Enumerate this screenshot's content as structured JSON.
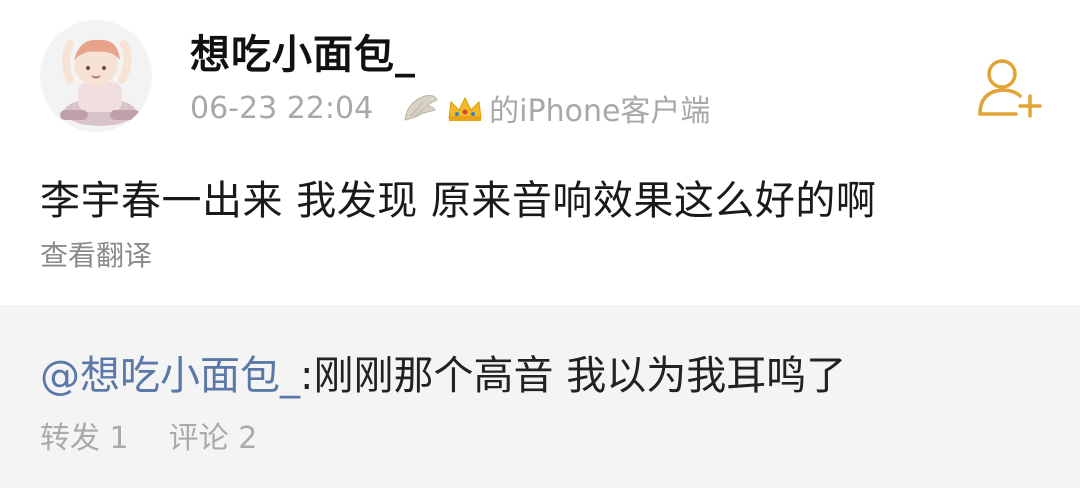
{
  "post": {
    "username": "想吃小面包_",
    "time": "06-23 22:04",
    "source": "的iPhone客户端",
    "content": "李宇春一出来 我发现 原来音响效果这么好的啊",
    "translate_label": "查看翻译",
    "follow_icon": "add-user-icon"
  },
  "repost": {
    "mention": "@想吃小面包_",
    "text": ":刚刚那个高音 我以为我耳鸣了",
    "forward_label": "转发",
    "forward_count": "1",
    "comment_label": "评论",
    "comment_count": "2"
  },
  "colors": {
    "accent": "#e2a437",
    "mention": "#5b79a8",
    "repost_bg": "#f4f4f4",
    "muted": "#a8a8a8"
  }
}
